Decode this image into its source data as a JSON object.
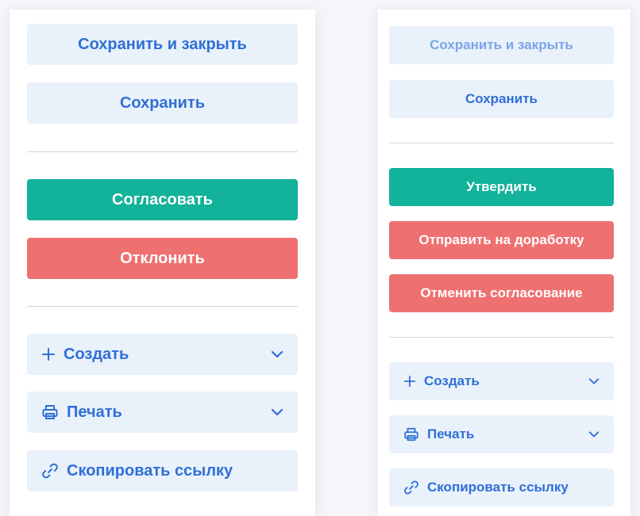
{
  "left_panel": {
    "save_close": "Сохранить и закрыть",
    "save": "Сохранить",
    "approve": "Согласовать",
    "reject": "Отклонить",
    "create": {
      "label": "Создать",
      "icon": "plus-icon",
      "dropdown_icon": "chevron-down-icon"
    },
    "print": {
      "label": "Печать",
      "icon": "printer-icon",
      "dropdown_icon": "chevron-down-icon"
    },
    "copy_link": {
      "label": "Скопировать ссылку",
      "icon": "link-icon"
    }
  },
  "right_panel": {
    "save_close": "Сохранить и закрыть",
    "save": "Сохранить",
    "confirm": "Утвердить",
    "send_for_revision": "Отправить на доработку",
    "cancel_approval": "Отменить согласование",
    "create": {
      "label": "Создать",
      "icon": "plus-icon",
      "dropdown_icon": "chevron-down-icon"
    },
    "print": {
      "label": "Печать",
      "icon": "printer-icon",
      "dropdown_icon": "chevron-down-icon"
    },
    "copy_link": {
      "label": "Скопировать ссылку",
      "icon": "link-icon"
    }
  },
  "colors": {
    "light_button_bg": "#e9f1fb",
    "light_button_text": "#2f6fd6",
    "disabled_text": "#7aa5e8",
    "green": "#12b29b",
    "red": "#ef7070",
    "divider": "#cfd6de"
  }
}
